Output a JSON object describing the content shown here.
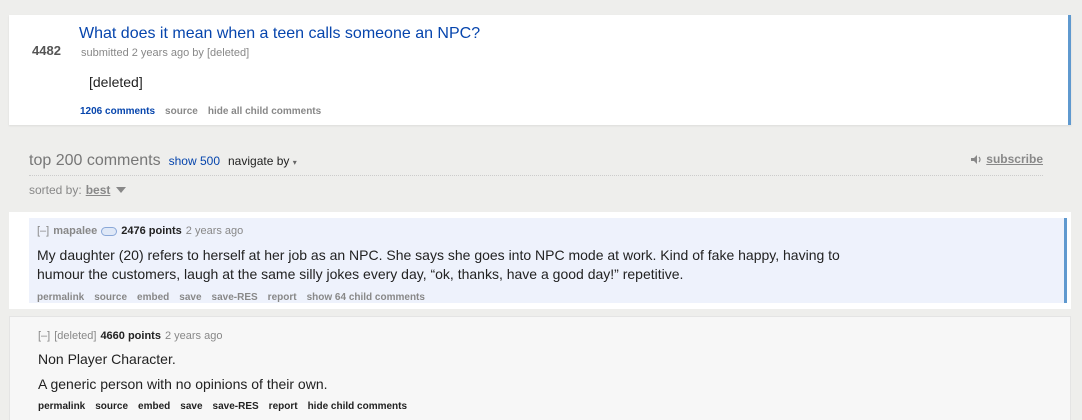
{
  "post": {
    "score": "4482",
    "title": "What does it mean when a teen calls someone an NPC?",
    "tagline": "submitted 2 years ago by [deleted]",
    "body": "[deleted]",
    "actions": [
      "1206 comments",
      "source",
      "hide all child comments"
    ]
  },
  "comments_header": {
    "title": "top 200 comments",
    "show": "show 500",
    "navigate": "navigate by",
    "nav_arrow": "▾",
    "subscribe": "subscribe",
    "sorted_by": "sorted by:",
    "sort_value": "best"
  },
  "comments": [
    {
      "toggle": "[–]",
      "author": "mapalee",
      "points": "2476 points",
      "age": "2 years ago",
      "body": [
        "My daughter (20) refers to herself at her job as an NPC. She says she goes into NPC mode at work. Kind of fake happy, having to",
        "humour the customers, laugh at the same silly jokes every day, “ok, thanks, have a good day!” repetitive."
      ],
      "actions": [
        "permalink",
        "source",
        "embed",
        "save",
        "save-RES",
        "report",
        "show 64 child comments"
      ]
    },
    {
      "toggle": "[–]",
      "author": "[deleted]",
      "points": "4660 points",
      "age": "2 years ago",
      "body": [
        "Non Player Character.",
        "A generic person with no opinions of their own."
      ],
      "actions": [
        "permalink",
        "source",
        "embed",
        "save",
        "save-RES",
        "report",
        "hide child comments"
      ]
    }
  ],
  "colors": {
    "link": "#0645ad",
    "accent": "#5f99cf",
    "background": "#eeeeec"
  },
  "icons": {
    "subscribe": "speaker-icon",
    "user_tag": "tag-icon",
    "sort": "caret-down-icon"
  }
}
